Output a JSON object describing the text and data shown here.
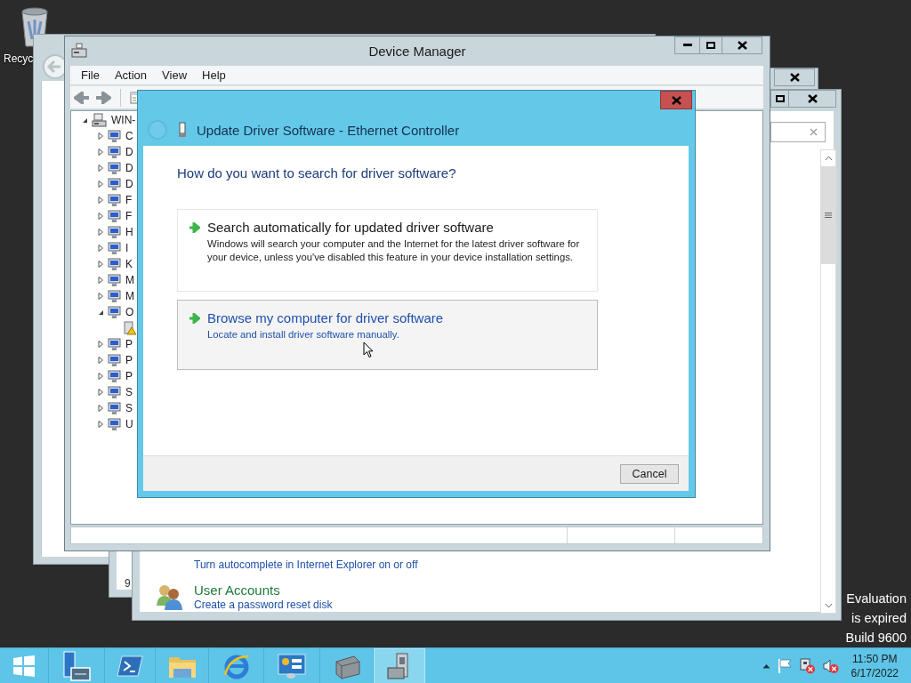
{
  "desktop": {
    "recycle_bin_label": "Recyc"
  },
  "watermark": [
    "Evaluation",
    "is expired",
    "Build 9600"
  ],
  "partial_window": {
    "text": "9"
  },
  "control_panel": {
    "links": [
      "Turn autocomplete in Internet Explorer on or off"
    ],
    "category": {
      "title": "User Accounts",
      "link": "Create a password reset disk"
    }
  },
  "device_manager": {
    "title": "Device Manager",
    "menu": [
      "File",
      "Action",
      "View",
      "Help"
    ],
    "tree": {
      "label": "WIN-",
      "kind": "computer",
      "expanded": true,
      "children": [
        {
          "label": "C",
          "expanded": false
        },
        {
          "label": "D",
          "expanded": false
        },
        {
          "label": "D",
          "expanded": false
        },
        {
          "label": "D",
          "expanded": false
        },
        {
          "label": "F",
          "expanded": false
        },
        {
          "label": "F",
          "expanded": false
        },
        {
          "label": "H",
          "expanded": false
        },
        {
          "label": "I",
          "expanded": false
        },
        {
          "label": "K",
          "expanded": false
        },
        {
          "label": "M",
          "expanded": false
        },
        {
          "label": "M",
          "expanded": false
        },
        {
          "label": "O",
          "expanded": true,
          "children": [
            {
              "kind": "unknown-device"
            }
          ]
        },
        {
          "label": "P",
          "expanded": false
        },
        {
          "label": "P",
          "expanded": false
        },
        {
          "label": "P",
          "expanded": false
        },
        {
          "label": "S",
          "expanded": false
        },
        {
          "label": "S",
          "expanded": false
        },
        {
          "label": "U",
          "expanded": false
        }
      ]
    }
  },
  "dialog": {
    "title": "Update Driver Software - Ethernet Controller",
    "question": "How do you want to search for driver software?",
    "options": [
      {
        "title": "Search automatically for updated driver software",
        "description": "Windows will search your computer and the Internet for the latest driver software for your device, unless you've disabled this feature in your device installation settings.",
        "hovered": false
      },
      {
        "title": "Browse my computer for driver software",
        "description": "Locate and install driver software manually.",
        "hovered": true
      }
    ],
    "buttons": [
      "Cancel"
    ]
  },
  "taskbar": {
    "apps": [
      {
        "kind": "start",
        "selected": false
      },
      {
        "kind": "server-manager",
        "selected": false
      },
      {
        "kind": "powershell",
        "selected": false
      },
      {
        "kind": "file-explorer",
        "selected": false
      },
      {
        "kind": "internet-explorer",
        "selected": false
      },
      {
        "kind": "control-panel",
        "selected": false
      },
      {
        "kind": "toolbox",
        "selected": false
      },
      {
        "kind": "device-manager",
        "selected": true
      }
    ],
    "clock": {
      "time": "11:50 PM",
      "date": "6/17/2022"
    }
  }
}
